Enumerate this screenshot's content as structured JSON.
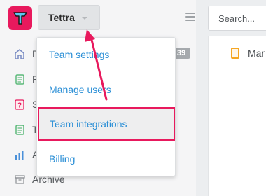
{
  "header": {
    "team_name": "Tettra",
    "search_placeholder": "Search..."
  },
  "sidebar": {
    "items": [
      {
        "label": "D",
        "icon": "home-icon"
      },
      {
        "label": "P",
        "icon": "document-icon"
      },
      {
        "label": "S",
        "icon": "question-icon"
      },
      {
        "label": "T",
        "icon": "document-icon"
      },
      {
        "label": "A",
        "icon": "bar-chart-icon"
      },
      {
        "label": "Archive",
        "icon": "archive-icon"
      }
    ],
    "badge": "39"
  },
  "dropdown": {
    "items": [
      {
        "label": "Team settings"
      },
      {
        "label": "Manage users"
      },
      {
        "label": "Team integrations",
        "highlighted": true
      },
      {
        "label": "Billing"
      }
    ]
  },
  "main": {
    "doc_title": "Mar"
  },
  "colors": {
    "brand": "#e8195d",
    "link": "#2b8fd6",
    "annotation": "#e8195d"
  }
}
